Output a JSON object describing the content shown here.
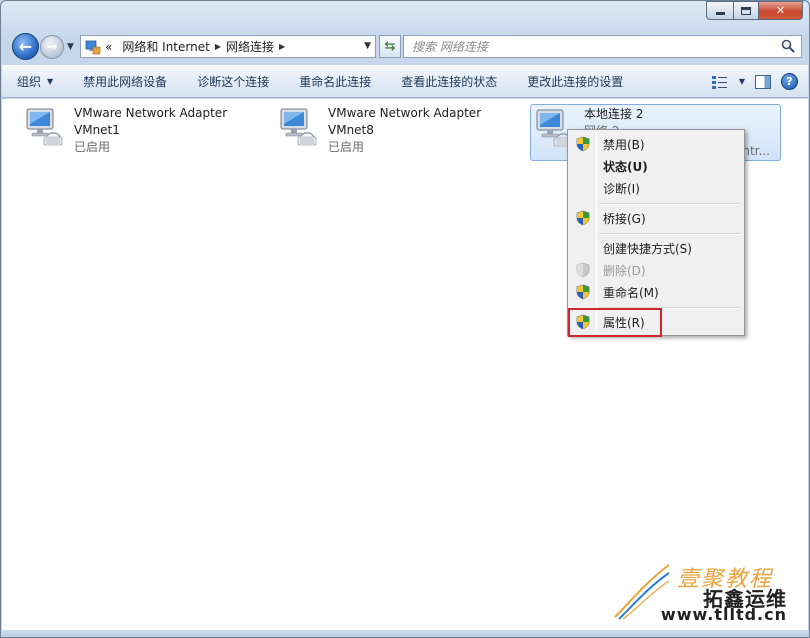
{
  "window": {
    "controls": {
      "minimize": "minimize",
      "maximize": "maximize",
      "close": "✕"
    }
  },
  "address": {
    "overflow": "«",
    "crumbs": [
      "网络和 Internet",
      "网络连接"
    ]
  },
  "search": {
    "placeholder": "搜索 网络连接"
  },
  "toolbar": {
    "organize": "组织",
    "disable_device": "禁用此网络设备",
    "diagnose": "诊断这个连接",
    "rename": "重命名此连接",
    "view_status": "查看此连接的状态",
    "change_settings": "更改此连接的设置"
  },
  "connections": [
    {
      "name": "VMware Network Adapter",
      "sub": "VMnet1",
      "status": "已启用"
    },
    {
      "name": "VMware Network Adapter",
      "sub": "VMnet8",
      "status": "已启用"
    },
    {
      "name": "本地连接 2",
      "sub": "网络 2",
      "device_trunc": "ontr..."
    }
  ],
  "context_menu": {
    "items": [
      {
        "label": "禁用(B)",
        "icon": "shield-icon"
      },
      {
        "label": "状态(U)",
        "icon": ""
      },
      {
        "label": "诊断(I)",
        "icon": ""
      },
      {
        "label": "桥接(G)",
        "icon": "shield-icon"
      },
      {
        "label": "创建快捷方式(S)",
        "icon": ""
      },
      {
        "label": "删除(D)",
        "icon": "shield-icon-disabled"
      },
      {
        "label": "重命名(M)",
        "icon": "shield-icon"
      },
      {
        "label": "属性(R)",
        "icon": "shield-icon"
      }
    ]
  },
  "watermark": {
    "brand_top": "壹聚教程",
    "brand_cn": "拓鑫运维",
    "url": "www.tlltd.cn"
  },
  "colors": {
    "highlight_box": "#d0272f",
    "accent": "#1d57a8"
  }
}
